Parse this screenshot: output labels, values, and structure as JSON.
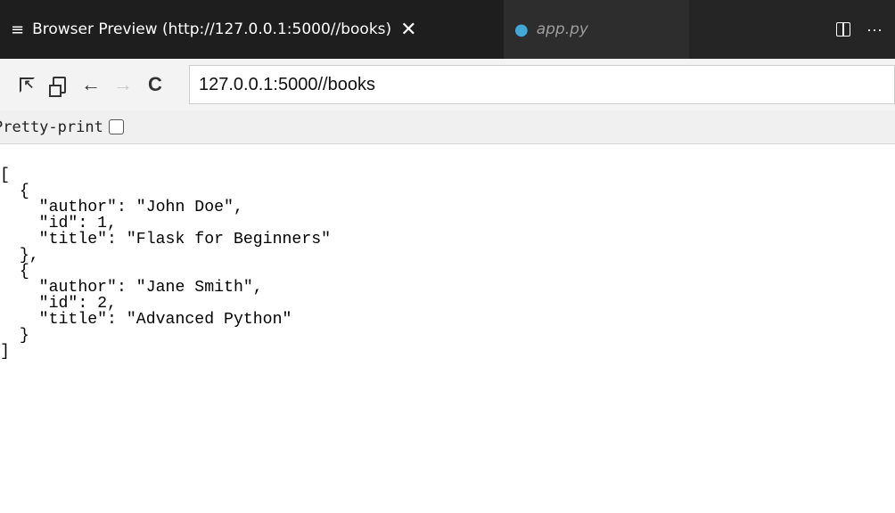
{
  "tabs": [
    {
      "label": "Browser Preview (http://127.0.0.1:5000//books)",
      "icon": "menu-lines-icon",
      "active": true,
      "close_glyph": "✕"
    },
    {
      "label": "app.py",
      "icon": "python-icon",
      "active": false
    }
  ],
  "tab_actions": {
    "split": "split-editor-icon",
    "more_glyph": "···"
  },
  "nav": {
    "back_glyph": "←",
    "forward_glyph": "→",
    "reload_glyph": "C",
    "url": "127.0.0.1:5000//books"
  },
  "pretty_print": {
    "label": "Pretty-print",
    "checked": false
  },
  "json_lines": [
    "[",
    "  {",
    "    \"author\": \"John Doe\",",
    "    \"id\": 1,",
    "    \"title\": \"Flask for Beginners\"",
    "  },",
    "  {",
    "    \"author\": \"Jane Smith\",",
    "    \"id\": 2,",
    "    \"title\": \"Advanced Python\"",
    "  }",
    "]"
  ],
  "colors": {
    "tabbar_bg": "#252526",
    "active_tab_bg": "#1e1e1e",
    "python_icon": "#3fa8d6"
  }
}
